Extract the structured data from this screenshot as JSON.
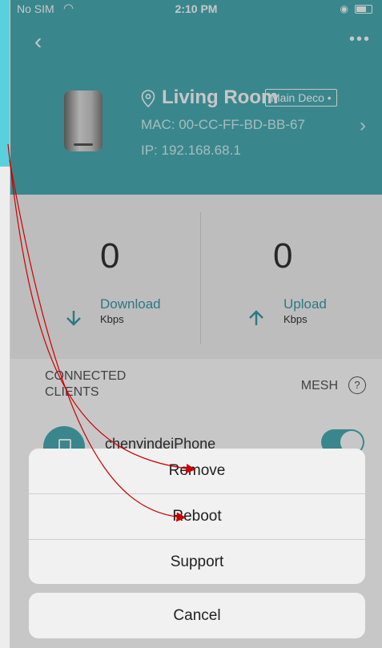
{
  "status_bar": {
    "carrier": "No SIM",
    "time": "2:10 PM"
  },
  "header": {
    "location": "Living Room",
    "tag": "Main Deco",
    "mac": "MAC: 00-CC-FF-BD-BB-67",
    "ip": "IP: 192.168.68.1"
  },
  "stats": {
    "download": {
      "value": "0",
      "label": "Download",
      "unit": "Kbps"
    },
    "upload": {
      "value": "0",
      "label": "Upload",
      "unit": "Kbps"
    }
  },
  "clients": {
    "title": "CONNECTED CLIENTS",
    "mesh_label": "MESH",
    "help": "?",
    "items": [
      {
        "name": "chenyindeiPhone",
        "enabled": true
      }
    ]
  },
  "action_sheet": {
    "options": [
      "Remove",
      "Reboot",
      "Support"
    ],
    "cancel": "Cancel"
  },
  "colors": {
    "accent": "#4aaeb5",
    "annotation": "#cc0000"
  },
  "icons": {
    "back": "chevron-left-icon",
    "more": "more-icon",
    "location": "location-pin-icon",
    "download": "arrow-down-icon",
    "upload": "arrow-up-icon",
    "help": "help-icon"
  }
}
